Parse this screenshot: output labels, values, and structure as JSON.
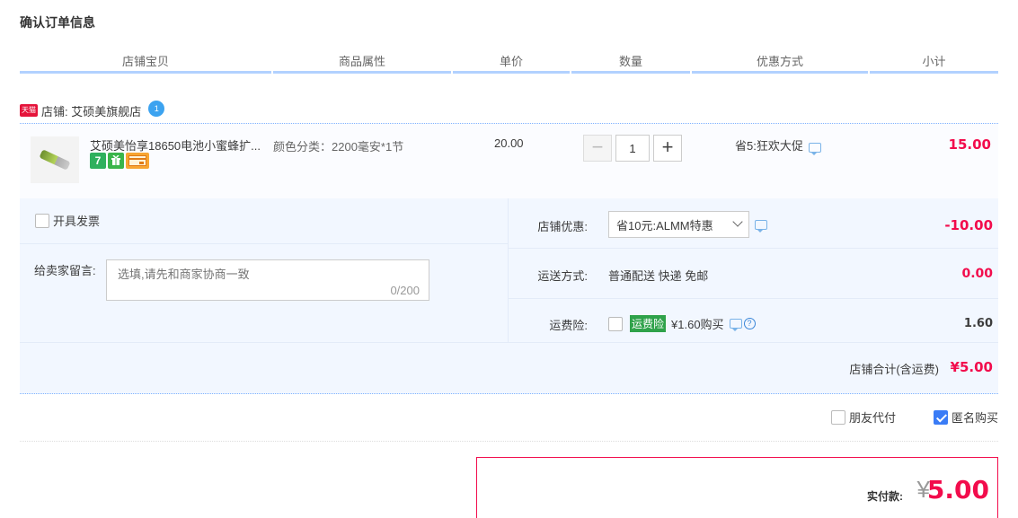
{
  "title": "确认订单信息",
  "columns": [
    "店铺宝贝",
    "商品属性",
    "单价",
    "数量",
    "优惠方式",
    "小计"
  ],
  "shop": {
    "badge": "天猫",
    "name": "店铺: 艾硕美旗舰店"
  },
  "item": {
    "name": "艾硕美怡享18650电池小蜜蜂扩...",
    "tags": [
      "7",
      "",
      ""
    ],
    "attribute": "颜色分类：2200毫安*1节",
    "price": "20.00",
    "quantity": "1",
    "minus": "−",
    "plus": "+",
    "promo": "省5:狂欢大促",
    "subtotal": "15.00"
  },
  "invoice_label": "开具发票",
  "message": {
    "label": "给卖家留言:",
    "placeholder": "选填,请先和商家协商一致",
    "count": "0/200"
  },
  "shop_discount": {
    "label": "店铺优惠:",
    "selected": "省10元:ALMM特惠",
    "amount": "-10.00"
  },
  "shipping": {
    "label": "运送方式:",
    "value": "普通配送 快递 免邮",
    "amount": "0.00"
  },
  "insurance": {
    "label": "运费险:",
    "badge": "运费险",
    "text": "¥1.60购买",
    "amount": "1.60"
  },
  "shop_total": {
    "label": "店铺合计(含运费)",
    "amount": "¥5.00"
  },
  "options": {
    "friend_pay": "朋友代付",
    "anonymous": "匿名购买"
  },
  "payment": {
    "label": "实付款:",
    "currency": "¥",
    "total": "5.00"
  },
  "colors": {
    "accent_red": "#f20c4c",
    "header_line": "#b2d1ff",
    "panel_bg": "#f2f7ff"
  }
}
